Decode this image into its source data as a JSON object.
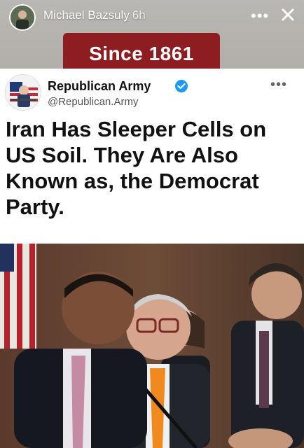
{
  "story": {
    "username": "Michael Bazsuly",
    "time": "6h",
    "more_label": "•••",
    "close_label": "close",
    "sticker_text": "Since 1861"
  },
  "post": {
    "author_name": "Republican Army",
    "handle": "@Republican.Army",
    "more_label": "•••",
    "headline": "Iran Has Sleeper Cells on US Soil. They Are Also Known as, the Democrat Party."
  },
  "colors": {
    "sticker_bg": "#8e1d22",
    "verified_blue": "#1d9bf0"
  },
  "icons": {
    "close": "close-icon",
    "verified": "verified-check-icon",
    "more": "more-horizontal-icon"
  }
}
